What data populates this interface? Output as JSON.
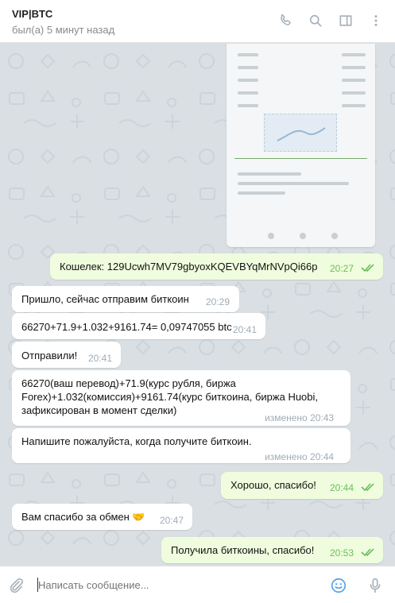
{
  "header": {
    "title": "VIP|BTC",
    "status": "был(а) 5 минут назад",
    "icons": [
      "phone-icon",
      "search-icon",
      "sidebar-toggle-icon",
      "more-icon"
    ]
  },
  "messages": [
    {
      "dir": "out",
      "text": "Кошелек: 129Ucwh7MV79gbyoxKQEVBYqMrNVpQi66p",
      "time": "20:27",
      "read": true
    },
    {
      "dir": "in",
      "text": "Пришло, сейчас отправим биткоин",
      "time": "20:29"
    },
    {
      "dir": "in",
      "text": "66270+71.9+1.032+9161.74= 0,09747055 btc",
      "time": "20:41"
    },
    {
      "dir": "in",
      "text": "Отправили!",
      "time": "20:41"
    },
    {
      "dir": "in",
      "text": "66270(ваш перевод)+71.9(курс рубля, биржа\nForex)+1.032(комиссия)+9161.74(курс биткоина, биржа Huobi,\nзафиксирован в момент сделки)",
      "time": "изменено 20:43"
    },
    {
      "dir": "in",
      "text": "Напишите пожалуйста, когда получите биткоин.",
      "time": "изменено 20:44"
    },
    {
      "dir": "out",
      "text": "Хорошо, спасибо!",
      "time": "20:44",
      "read": true
    },
    {
      "dir": "in",
      "text": "Вам спасибо за обмен 🤝",
      "time": "20:47"
    },
    {
      "dir": "out",
      "text": "Получила биткоины, спасибо!",
      "time": "20:53",
      "read": true
    }
  ],
  "composer": {
    "placeholder": "Написать сообщение...",
    "icons": [
      "attach-icon",
      "emoji-icon",
      "microphone-icon"
    ]
  },
  "colors": {
    "accent": "#50a2e9",
    "outgoing_bubble": "#effdde",
    "incoming_bubble": "#ffffff",
    "read_ticks": "#6cbe5a",
    "chat_background": "#d9dfe3"
  }
}
